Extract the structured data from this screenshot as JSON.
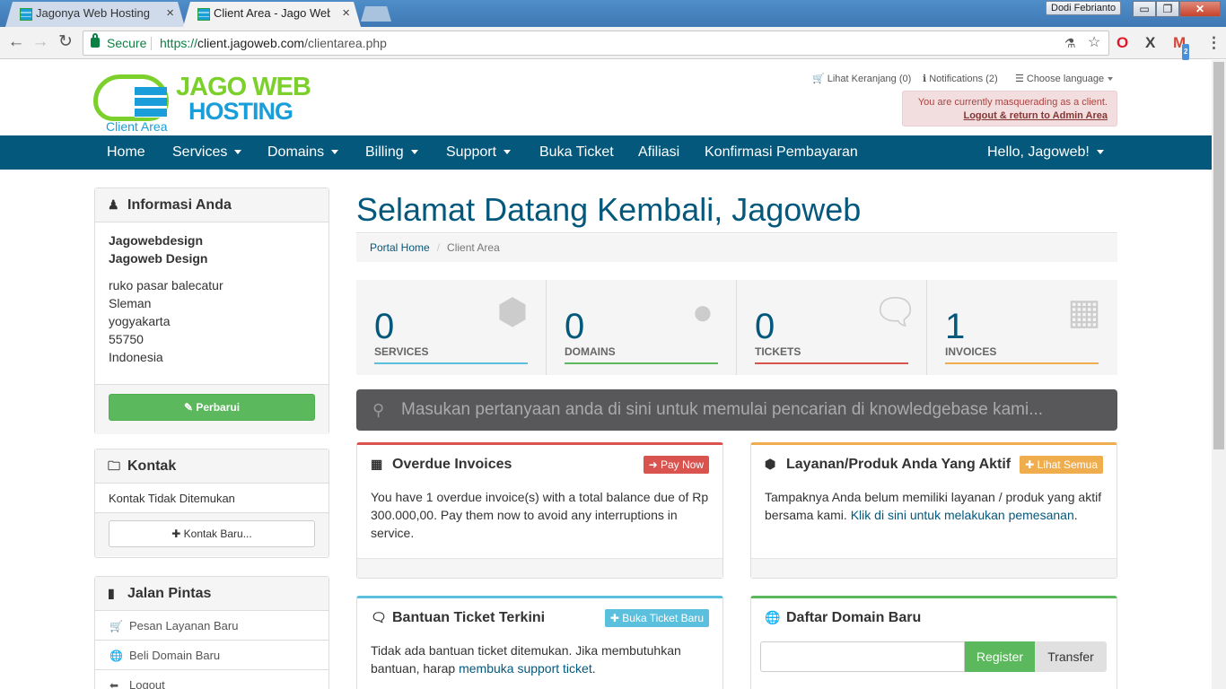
{
  "browser": {
    "tabs": [
      {
        "title": "Jagonya Web Hosting M",
        "close": "×"
      },
      {
        "title": "Client Area - Jago Web H",
        "close": "×"
      }
    ],
    "profile": "Dodi Febrianto",
    "window_controls": {
      "minimize": "▭",
      "maximize": "❐",
      "close": "✕"
    },
    "secure_label": "Secure",
    "url_scheme": "https://",
    "url_host": "client.jagoweb.com",
    "url_path": "/clientarea.php",
    "gmail_badge": "2"
  },
  "logo": {
    "line1": "JAGO WEB",
    "line2": "HOSTING",
    "sub": "Client Area"
  },
  "toplinks": {
    "cart": "Lihat Keranjang (0)",
    "notifications": "Notifications (2)",
    "language": "Choose language"
  },
  "masquerade": {
    "message": "You are currently masquerading as a client.",
    "logout": "Logout & return to Admin Area"
  },
  "nav": {
    "home": "Home",
    "services": "Services",
    "domains": "Domains",
    "billing": "Billing",
    "support": "Support",
    "buka_ticket": "Buka Ticket",
    "afiliasi": "Afiliasi",
    "konfirmasi": "Konfirmasi Pembayaran",
    "user": "Hello, Jagoweb!"
  },
  "info_panel": {
    "title": "Informasi Anda",
    "lines_bold": [
      "Jagowebdesign",
      "Jagoweb Design"
    ],
    "address": [
      "ruko pasar balecatur",
      "Sleman",
      "yogyakarta",
      "55750",
      "Indonesia"
    ],
    "update_button": "Perbarui"
  },
  "contact_panel": {
    "title": "Kontak",
    "empty": "Kontak Tidak Ditemukan",
    "new_button": "Kontak Baru..."
  },
  "shortcuts_panel": {
    "title": "Jalan Pintas",
    "items": [
      "Pesan Layanan Baru",
      "Beli Domain Baru",
      "Logout"
    ]
  },
  "page_title": "Selamat Datang Kembali, Jagoweb",
  "breadcrumb": {
    "home": "Portal Home",
    "separator": "/",
    "current": "Client Area"
  },
  "stats": [
    {
      "value": "0",
      "label": "SERVICES",
      "color": "#5bc0de"
    },
    {
      "value": "0",
      "label": "DOMAINS",
      "color": "#5cb85c"
    },
    {
      "value": "0",
      "label": "TICKETS",
      "color": "#d9534f"
    },
    {
      "value": "1",
      "label": "INVOICES",
      "color": "#f0ad4e"
    }
  ],
  "kb_search": {
    "placeholder": "Masukan pertanyaan anda di sini untuk memulai pencarian di knowledgebase kami..."
  },
  "overdue": {
    "title": "Overdue Invoices",
    "button": "Pay Now",
    "body": "You have 1 overdue invoice(s) with a total balance due of Rp 300.000,00. Pay them now to avoid any interruptions in service."
  },
  "active_services": {
    "title": "Layanan/Produk Anda Yang Aktif",
    "button": "Lihat Semua",
    "body_text": "Tampaknya Anda belum memiliki layanan / produk yang aktif bersama kami.",
    "body_link": "Klik di sini untuk melakukan pemesanan",
    "body_end": "."
  },
  "tickets": {
    "title": "Bantuan Ticket Terkini",
    "button": "Buka Ticket Baru",
    "body_text": "Tidak ada bantuan ticket ditemukan. Jika membutuhkan bantuan, harap",
    "body_link": "membuka support ticket",
    "body_end": "."
  },
  "domain_register": {
    "title": "Daftar Domain Baru",
    "register": "Register",
    "transfer": "Transfer"
  },
  "colors": {
    "brand": "#04587c",
    "danger": "#d9534f",
    "warning": "#f0ad4e",
    "success": "#5cb85c",
    "info": "#5bc0de"
  }
}
